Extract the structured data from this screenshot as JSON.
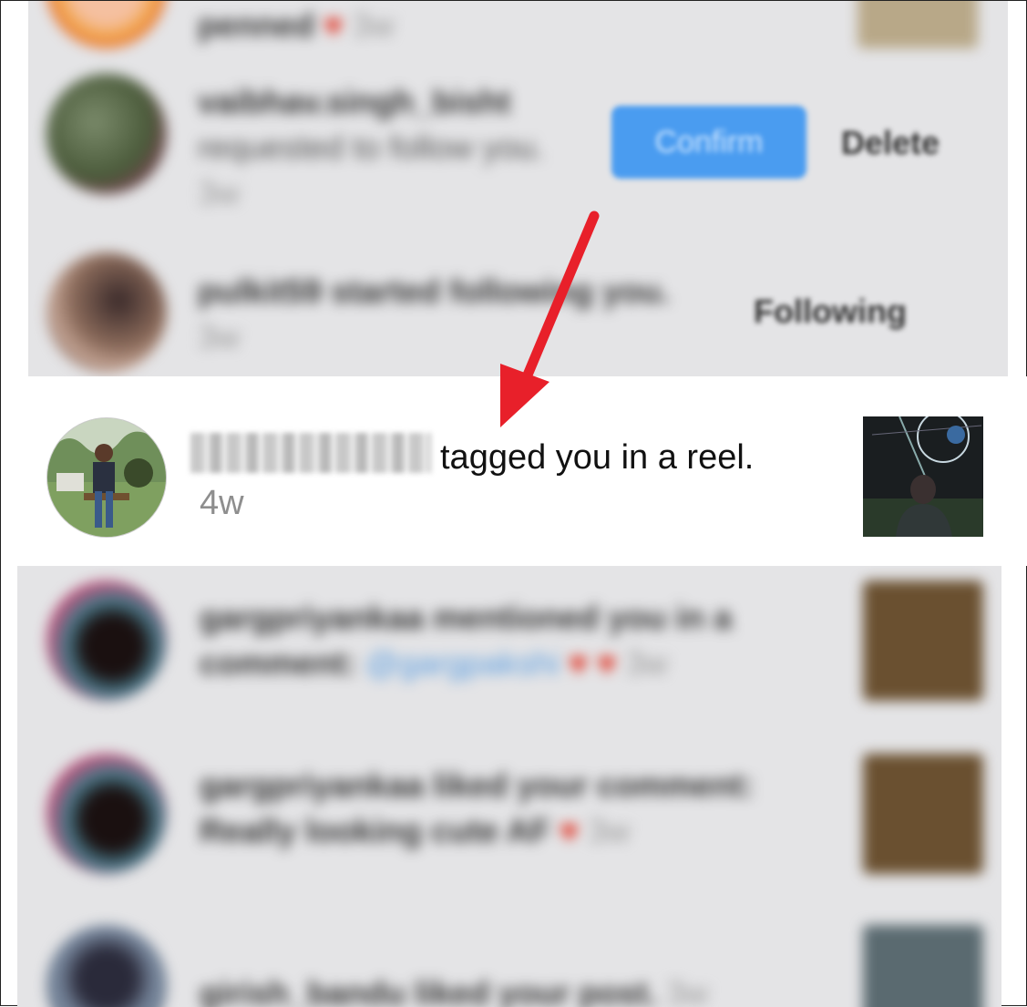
{
  "top_rows": [
    {
      "text": "penned",
      "time": "3w",
      "heart": "♥"
    },
    {
      "username": "vaibhav.singh_bisht",
      "text": "requested to follow you.",
      "time": "3w",
      "confirm": "Confirm",
      "delete": "Delete"
    },
    {
      "text": "pulkit59 started following you.",
      "time": "3w",
      "button": "Following"
    }
  ],
  "focused": {
    "text": "tagged you in a reel.",
    "time": "4w"
  },
  "bottom_rows": [
    {
      "text": "gargpriyankaa mentioned you in a comment:",
      "mention": "@gargpakshi",
      "time": "3w",
      "hearts": "♥ ♥"
    },
    {
      "text": "gargpriyankaa liked your comment: Really looking cute AF",
      "time": "3w",
      "heart": "♥"
    },
    {
      "text": "girish_bandu liked your post.",
      "time": "3w"
    }
  ],
  "colors": {
    "accent_blue": "#4a9cf0",
    "arrow_red": "#e8202a",
    "timestamp_gray": "#8e8e8e"
  }
}
